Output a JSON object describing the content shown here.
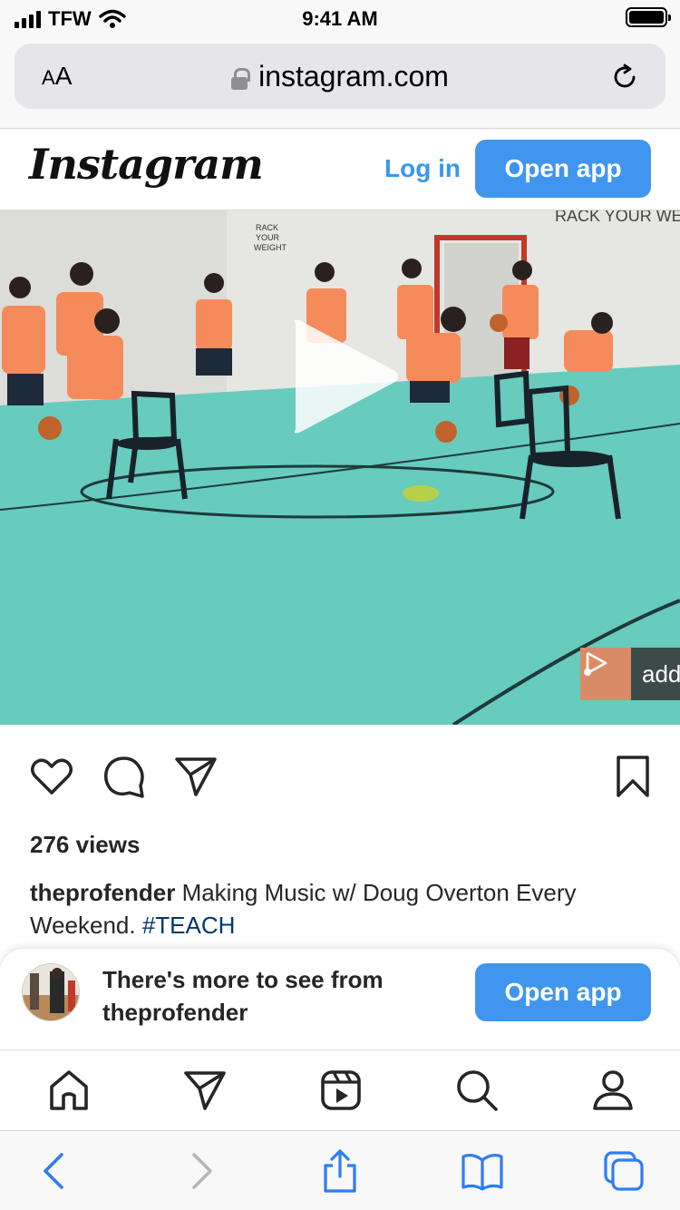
{
  "status_bar": {
    "carrier": "TFW",
    "time": "9:41 AM"
  },
  "browser": {
    "text_size_button": {
      "big": "A",
      "small": "A"
    },
    "url": "instagram.com",
    "icons": [
      "lock-icon",
      "reload-icon"
    ]
  },
  "header": {
    "logo": "Instagram",
    "login_label": "Log in",
    "open_app_label": "Open app"
  },
  "video": {
    "audio_badge_label": "add",
    "icons": [
      "play-icon",
      "music-note-icon"
    ]
  },
  "post": {
    "action_icons": [
      "heart-icon",
      "comment-icon",
      "share-icon",
      "bookmark-icon"
    ],
    "views": "276 views",
    "caption_user": "theprofender",
    "caption_text": " Making Music w/ Doug Overton Every Weekend. ",
    "caption_tag": "#TEACH"
  },
  "banner": {
    "text_line1": "There's more to see from",
    "text_line2": "theprofender",
    "open_app_label": "Open app"
  },
  "ig_nav": {
    "items": [
      "home-icon",
      "direct-icon",
      "reels-icon",
      "search-icon",
      "profile-icon"
    ]
  },
  "safari_toolbar": {
    "items": [
      "back-icon",
      "forward-icon",
      "share-icon",
      "bookmarks-icon",
      "tabs-icon"
    ]
  },
  "colors": {
    "accent_blue": "#4096ee",
    "link_blue": "#3897f0",
    "hashtag": "#00376b",
    "safari_tint": "#2f7cf6",
    "court": "#66c9bd"
  }
}
